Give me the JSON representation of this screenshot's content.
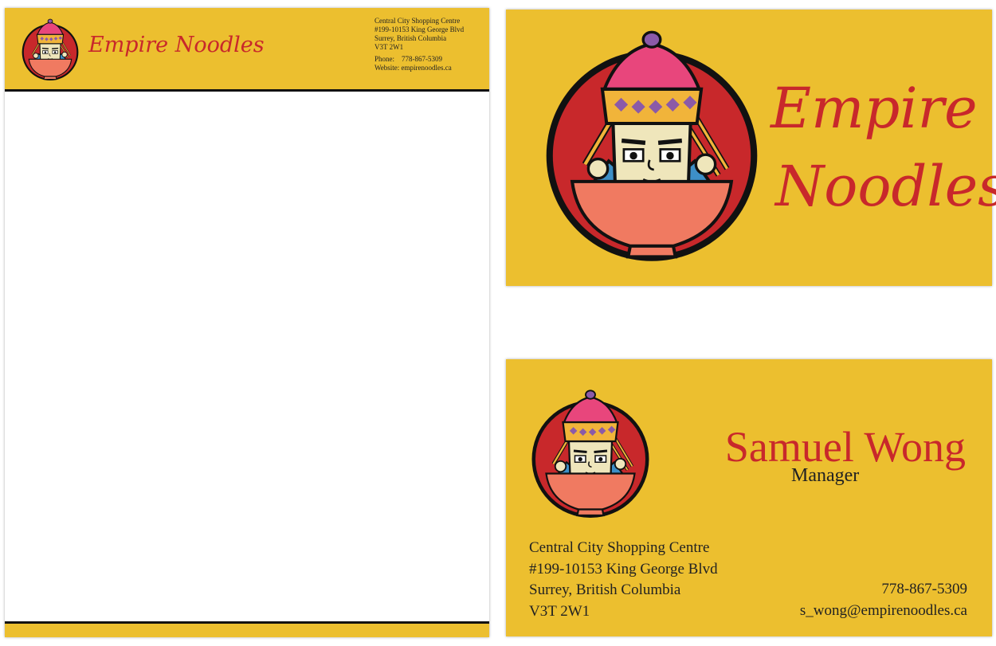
{
  "letterhead": {
    "brand": "Empire Noodles",
    "address_lines": [
      "Central City Shopping Centre",
      "#199-10153 King George Blvd",
      "Surrey, British Columbia",
      "V3T 2W1"
    ],
    "phone_label": "Phone:",
    "phone": "778-867-5309",
    "website_label": "Website:",
    "website": "empirenoodles.ca"
  },
  "card_front": {
    "brand_line1": "Empire",
    "brand_line2": "Noodles"
  },
  "card_back": {
    "name": "Samuel Wong",
    "title": "Manager",
    "address_lines": [
      "Central City Shopping Centre",
      "#199-10153 King George Blvd",
      "Surrey, British Columbia",
      "V3T 2W1"
    ],
    "phone": "778-867-5309",
    "email": "s_wong@empirenoodles.ca"
  },
  "colors": {
    "background_gold": "#ecbf2f",
    "brand_red": "#c8282b",
    "bowl_salmon": "#f07a61",
    "hat_pink": "#e8467c",
    "crown_gold": "#f1b43a",
    "gem_purple": "#8b5aa8",
    "face": "#efe6bb",
    "sleeve_blue": "#3d8fc7"
  },
  "icons": [
    "empire-noodles-logo-icon"
  ]
}
